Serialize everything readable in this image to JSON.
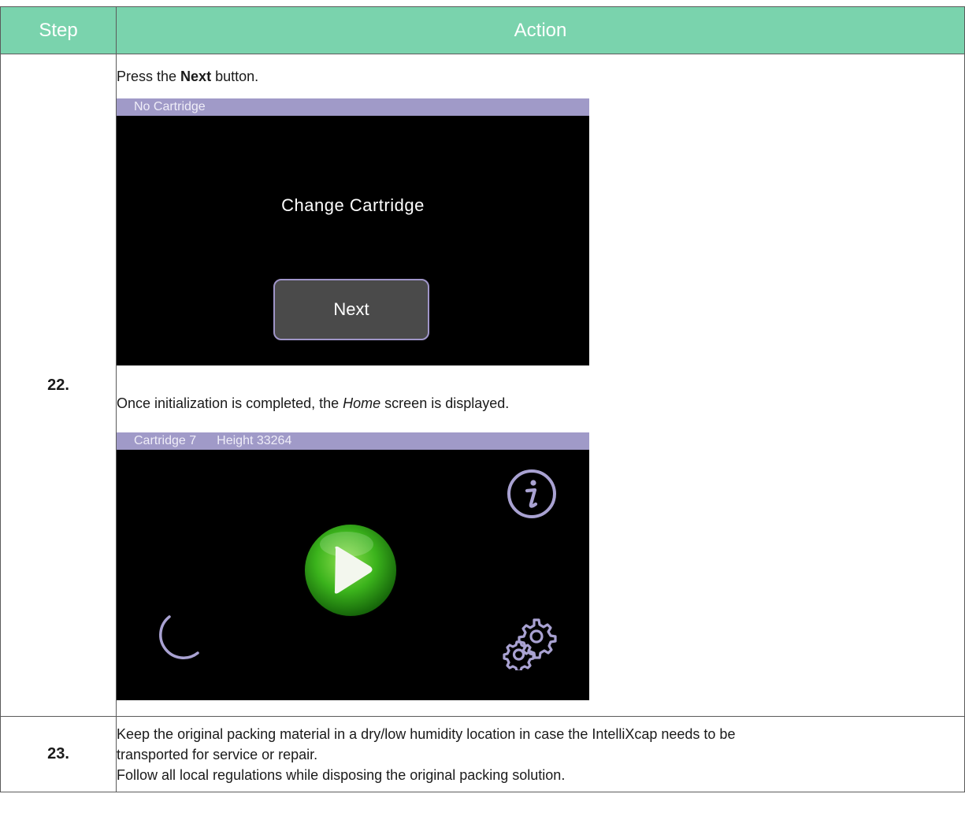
{
  "table": {
    "headers": {
      "step": "Step",
      "action": "Action"
    },
    "rows": [
      {
        "step": "22.",
        "intro_pre": "Press the ",
        "intro_bold": "Next",
        "intro_post": " button.",
        "screen1": {
          "titlebar": "No Cartridge",
          "label": "Change Cartridge",
          "button": "Next"
        },
        "middle_pre": "Once initialization is completed, the ",
        "middle_italic": "Home",
        "middle_post": " screen is displayed.",
        "screen2": {
          "titlebar_cartridge": "Cartridge 7",
          "titlebar_height": "Height 33264",
          "icons": [
            "info-icon",
            "play-icon",
            "moon-icon",
            "gear-icon"
          ]
        }
      },
      {
        "step": "23.",
        "line1": "Keep the original packing material in a dry/low humidity location in case the IntelliXcap needs to be",
        "line2": "transported for service or repair.",
        "line3": "Follow all local regulations while disposing the original packing solution."
      }
    ]
  },
  "colors": {
    "header_bg": "#7ad3ad",
    "titlebar_bg": "#a09ac8",
    "accent_purple": "#9f95c8",
    "play_green": "#3bb31c"
  }
}
